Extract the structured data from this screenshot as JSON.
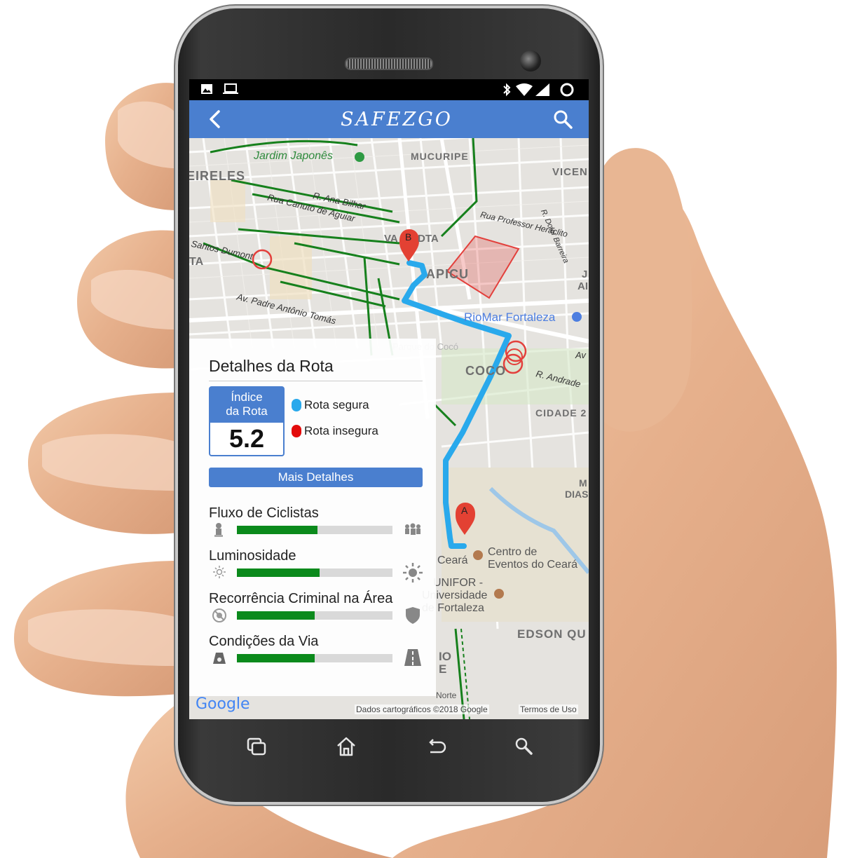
{
  "app": {
    "title": "SAFEZGO"
  },
  "map": {
    "labels": [
      "Jardim Japonês",
      "MUCURIPE",
      "EIRELES",
      "VICEN",
      "R. Ana Bilhar",
      "Rua Canuto de Aguiar",
      "Rua Professor Heráclito",
      "R. Dolor Barreira",
      "Santos Dumont",
      "TA",
      "VA",
      "DTA",
      "APICU",
      "Av. Padre Antônio Tomás",
      "RioMar Fortaleza",
      "COCO",
      "R. Andrade",
      "CIDADE 2",
      "Av",
      "M",
      "DIAS",
      "Centro de",
      "Eventos do Ceará",
      "UNIFOR -",
      "Universidade",
      "de Fortaleza",
      "EDSON QU",
      "Universidade Estácio do Ceará",
      "Parque do Cocó",
      "IO",
      "E",
      "Norte",
      "J",
      "AI",
      "Ceará"
    ],
    "markers": {
      "start": "A",
      "end": "B"
    },
    "footer": {
      "google": "Google",
      "attribution": "Dados cartográficos ©2018 Google",
      "terms": "Termos de Uso"
    },
    "route_color": "#29a9ec",
    "danger_color": "#e3403c"
  },
  "details": {
    "title": "Detalhes da Rota",
    "index_label_line1": "Índice",
    "index_label_line2": "da Rota",
    "index_value": "5.2",
    "legend_safe": "Rota segura",
    "legend_unsafe": "Rota insegura",
    "more_button": "Mais Detalhes",
    "metrics": [
      {
        "label": "Fluxo de Ciclistas",
        "level": 0.52,
        "icon_left": "single-person-icon",
        "icon_right": "crowd-icon"
      },
      {
        "label": "Luminosidade",
        "level": 0.53,
        "icon_left": "dim-sun-icon",
        "icon_right": "bright-sun-icon"
      },
      {
        "label": "Recorrência Criminal na Área",
        "level": 0.5,
        "icon_left": "no-crime-icon",
        "icon_right": "shield-icon"
      },
      {
        "label": "Condições da Via",
        "level": 0.5,
        "icon_left": "rough-road-icon",
        "icon_right": "good-road-icon"
      }
    ],
    "bar_color": "#0b8a1c",
    "safe_color": "#29a9ec",
    "unsafe_color": "#e30b0b",
    "accent": "#4a7fcf"
  }
}
